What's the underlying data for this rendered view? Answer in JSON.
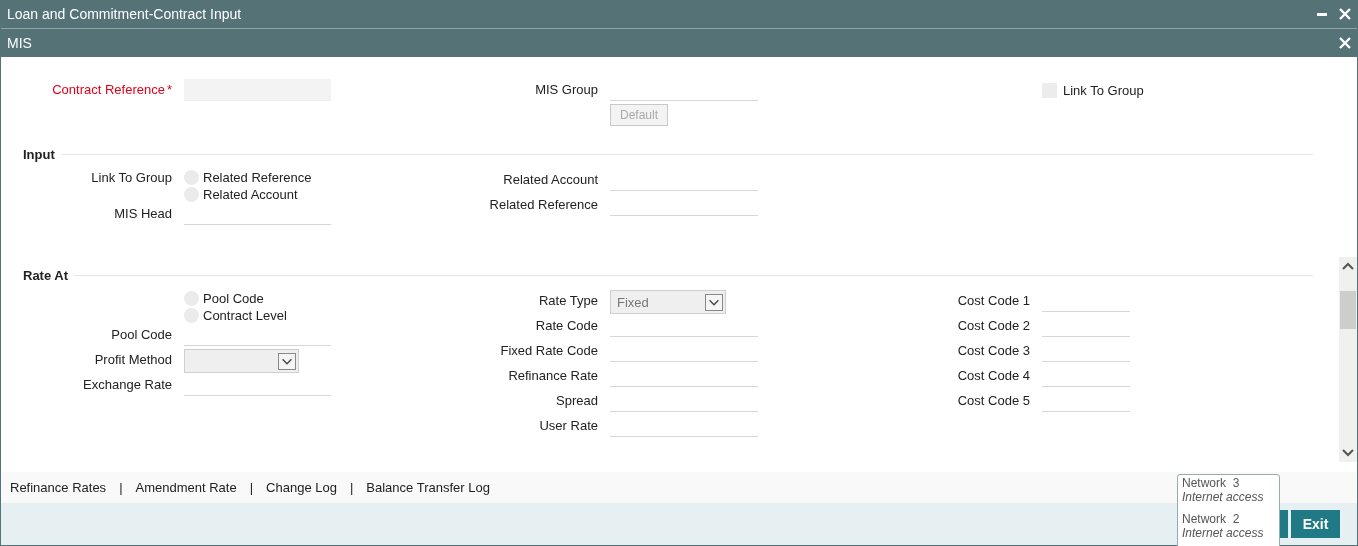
{
  "window": {
    "title": "Loan and Commitment-Contract Input"
  },
  "dialog": {
    "title": "MIS"
  },
  "header": {
    "columns": [
      [
        {
          "kind": "text",
          "label": "Contract Reference",
          "mark": "*",
          "disabled": true
        }
      ],
      [
        {
          "kind": "text",
          "label": "MIS Group"
        },
        {
          "kind": "button",
          "label": "Default",
          "disabled": true
        }
      ],
      [
        {
          "kind": "checkbox",
          "label": "Link To Group",
          "checked": false
        }
      ]
    ]
  },
  "sections": [
    {
      "title": "Input",
      "columns": [
        [
          {
            "kind": "radios",
            "label": "Link To Group",
            "options": [
              {
                "label": "Related Reference",
                "selected": false
              },
              {
                "label": "Related Account",
                "selected": false
              }
            ]
          },
          {
            "kind": "text",
            "label": "MIS Head"
          }
        ],
        [
          {
            "kind": "text",
            "label": "Related Account"
          },
          {
            "kind": "text",
            "label": "Related Reference"
          }
        ],
        []
      ]
    },
    {
      "title": "Rate At",
      "columns": [
        [
          {
            "kind": "radios",
            "options": [
              {
                "label": "Pool Code",
                "selected": false
              },
              {
                "label": "Contract Level",
                "selected": false
              }
            ]
          },
          {
            "kind": "text",
            "label": "Pool Code"
          },
          {
            "kind": "select",
            "label": "Profit Method",
            "disabled": true
          },
          {
            "kind": "text",
            "label": "Exchange Rate"
          }
        ],
        [
          {
            "kind": "select",
            "label": "Rate Type",
            "value": "Fixed",
            "disabled": true
          },
          {
            "kind": "text",
            "label": "Rate Code"
          },
          {
            "kind": "text",
            "label": "Fixed Rate Code"
          },
          {
            "kind": "text",
            "label": "Refinance Rate"
          },
          {
            "kind": "text",
            "label": "Spread"
          },
          {
            "kind": "text",
            "label": "User Rate"
          }
        ],
        [
          {
            "kind": "text",
            "label": "Cost Code 1"
          },
          {
            "kind": "text",
            "label": "Cost Code 2"
          },
          {
            "kind": "text",
            "label": "Cost Code 3"
          },
          {
            "kind": "text",
            "label": "Cost Code 4"
          },
          {
            "kind": "text",
            "label": "Cost Code 5"
          }
        ]
      ]
    }
  ],
  "links": {
    "separator": "|",
    "items": [
      "Refinance Rates",
      "Amendment Rate",
      "Change Log",
      "Balance Transfer Log"
    ]
  },
  "buttons": [
    {
      "label": "Exit"
    }
  ],
  "network_popup": {
    "items": [
      {
        "name": "Network  3",
        "status": "Internet access"
      },
      {
        "name": "Network  2",
        "status": "Internet access"
      }
    ]
  }
}
